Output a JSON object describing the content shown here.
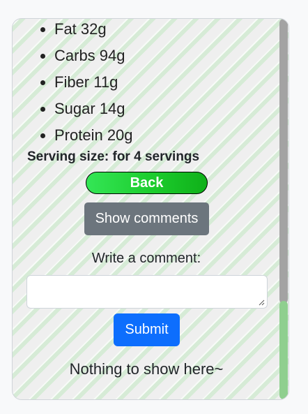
{
  "nutrition": {
    "items": [
      "Fat 32g",
      "Carbs 94g",
      "Fiber 11g",
      "Sugar 14g",
      "Protein 20g"
    ]
  },
  "serving": {
    "text": "Serving size: for 4 servings"
  },
  "buttons": {
    "back": "Back",
    "show_comments": "Show comments",
    "submit": "Submit"
  },
  "comment": {
    "label": "Write a comment:",
    "value": ""
  },
  "comments": {
    "empty_message": "Nothing to show here~"
  },
  "scrollbar": {
    "position_fraction": 0.74
  },
  "colors": {
    "back_gradient_start": "#34e656",
    "back_gradient_end": "#0fb019",
    "show_comments_bg": "#6c757d",
    "submit_bg": "#0d6efd",
    "stripe_green": "#d6ebd6",
    "scroll_thumb": "#8fcf8f"
  }
}
